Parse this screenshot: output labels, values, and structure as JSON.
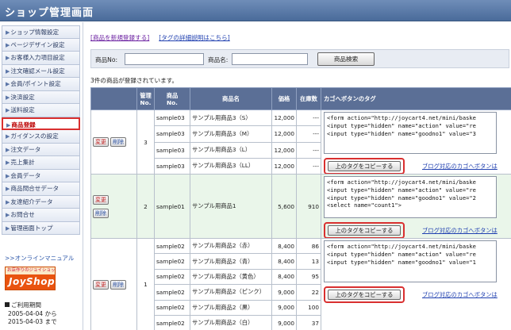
{
  "header": {
    "title": "ショップ管理画面"
  },
  "sidebar": {
    "items": [
      {
        "label": "ショップ情報設定",
        "active": false
      },
      {
        "label": "ページデザイン設定",
        "active": false
      },
      {
        "label": "お客様入力項目設定",
        "active": false
      },
      {
        "label": "注文確認メール設定",
        "active": false
      },
      {
        "label": "会員/ポイント設定",
        "active": false
      },
      {
        "label": "決済設定",
        "active": false
      },
      {
        "label": "送料設定",
        "active": false
      },
      {
        "label": "商品登録",
        "active": true
      },
      {
        "label": "ガイダンスの設定",
        "active": false
      },
      {
        "label": "注文データ",
        "active": false
      },
      {
        "label": "売上集計",
        "active": false
      },
      {
        "label": "会員データ",
        "active": false
      },
      {
        "label": "商品問合せデータ",
        "active": false
      },
      {
        "label": "友達紹介データ",
        "active": false
      },
      {
        "label": "お問合せ",
        "active": false
      },
      {
        "label": "管理画面トップ",
        "active": false
      }
    ],
    "manual_link": ">>オンラインマニュアル",
    "logo_tag": "お店作りのジョイショップ",
    "logo_name": "JoyShop",
    "usage_title": "ご利用期間",
    "usage_from": "2005-04-04 から",
    "usage_to": "2015-04-03 まで"
  },
  "links": {
    "new_product": "[商品を新規登録する]",
    "tag_help": "[タグの詳細説明はこちら]"
  },
  "search": {
    "product_no_label": "商品No:",
    "product_name_label": "商品名:",
    "product_no_value": "",
    "product_name_value": "",
    "button": "商品検索"
  },
  "count_text": "3件の商品が登録されています。",
  "table": {
    "headers": [
      "",
      "管理\nNo.",
      "商品\nNo.",
      "商品名",
      "価格",
      "在庫数",
      "カゴへボタンのタグ"
    ],
    "edit_label": "変更",
    "delete_label": "削除",
    "copy_label": "上のタグをコピーする",
    "blog_label": "ブログ対応のカゴへボタンは",
    "groups": [
      {
        "mgmt_no": "3",
        "rows": [
          {
            "product_no": "sample03",
            "name": "サンプル用商品3（S）",
            "price": "12,000",
            "stock": "---"
          },
          {
            "product_no": "sample03",
            "name": "サンプル用商品3（M）",
            "price": "12,000",
            "stock": "---"
          },
          {
            "product_no": "sample03",
            "name": "サンプル用商品3（L）",
            "price": "12,000",
            "stock": "---"
          },
          {
            "product_no": "sample03",
            "name": "サンプル用商品3（LL）",
            "price": "12,000",
            "stock": "---"
          }
        ],
        "tag_lines": [
          "<form action=\"http://joycart4.net/mini/baske",
          "<input type=\"hidden\" name=\"action\" value=\"re",
          "<input type=\"hidden\" name=\"goodno1\" value=\"3"
        ]
      },
      {
        "mgmt_no": "2",
        "rows": [
          {
            "product_no": "sample01",
            "name": "サンプル用商品1",
            "price": "5,600",
            "stock": "910"
          }
        ],
        "tag_lines": [
          "<form action=\"http://joycart4.net/mini/baske",
          "<input type=\"hidden\" name=\"action\" value=\"re",
          "<input type=\"hidden\" name=\"goodno1\" value=\"2",
          "<select name=\"count1\">"
        ]
      },
      {
        "mgmt_no": "1",
        "rows": [
          {
            "product_no": "sample02",
            "name": "サンプル用商品2（赤）",
            "price": "8,400",
            "stock": "86"
          },
          {
            "product_no": "sample02",
            "name": "サンプル用商品2（青）",
            "price": "8,400",
            "stock": "13"
          },
          {
            "product_no": "sample02",
            "name": "サンプル用商品2（黄色）",
            "price": "8,400",
            "stock": "95"
          },
          {
            "product_no": "sample02",
            "name": "サンプル用商品2（ピンク）",
            "price": "9,000",
            "stock": "22"
          },
          {
            "product_no": "sample02",
            "name": "サンプル用商品2（黒）",
            "price": "9,000",
            "stock": "100"
          },
          {
            "product_no": "sample02",
            "name": "サンプル用商品2（白）",
            "price": "9,000",
            "stock": "37"
          }
        ],
        "tag_lines": [
          "<form action=\"http://joycart4.net/mini/baske",
          "<input type=\"hidden\" name=\"action\" value=\"re",
          "<input type=\"hidden\" name=\"goodno1\" value=\"1"
        ]
      }
    ]
  }
}
